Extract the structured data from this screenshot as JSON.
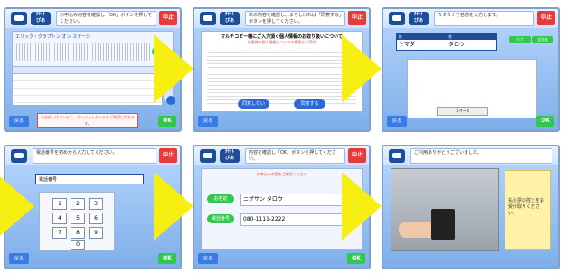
{
  "common": {
    "chip_top": "ﾁｹｯﾄ",
    "chip_bottom": "ぴあ",
    "stop": "中止",
    "back": "戻る",
    "ok": "OK"
  },
  "screens": [
    {
      "instruction": "お申込み内容を確認し「OK」ボタンを押してください。",
      "panel_title": "エリック・クラプトン オン ステージ",
      "warning": "お支払いはコンビニ、クレジットカードもご利用になれます。"
    },
    {
      "instruction": "次の内容を確認し、よろしければ「同意する」ボタンを押してください。",
      "title": "マルチコピー機にご入力頂く個人情報のお取り扱いについて",
      "subtitle": "お客様の個人情報についての重要なご案内",
      "agree_btn": "同意する",
      "disagree_btn": "同意しない"
    },
    {
      "instruction": "カタカナで名前を入力します。",
      "field_labels": [
        "姓",
        "名"
      ],
      "field_values": [
        "ヤマダ",
        "タロウ"
      ],
      "space": "スペース",
      "kana_btn": "カナ",
      "clear_btn": "全消去"
    },
    {
      "instruction": "電話番号を初めから入力してください。",
      "label": "電話番号",
      "keys": [
        "1",
        "2",
        "3",
        "4",
        "5",
        "6",
        "7",
        "8",
        "9",
        "0"
      ]
    },
    {
      "instruction": "内容を確認し「OK」ボタンを押してください。",
      "notice": "お申込み内容をご確認ください",
      "name_label": "お名前",
      "name_value": "ニザサン タロウ",
      "phone_label": "電話番号",
      "phone_value": "080-1111-2222"
    },
    {
      "instruction": "ご利用ありがとうございました。",
      "message": "払込票の控えをお受け取りください。"
    }
  ]
}
